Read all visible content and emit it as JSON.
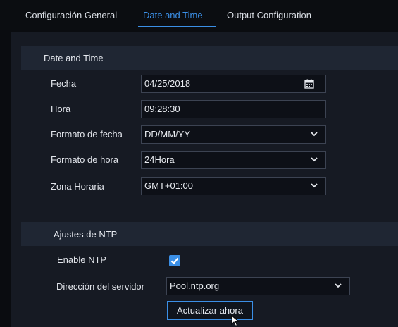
{
  "tabs": [
    {
      "label": "Configuración General",
      "active": false
    },
    {
      "label": "Date and Time",
      "active": true
    },
    {
      "label": "Output Configuration",
      "active": false
    }
  ],
  "date_time": {
    "section_title": "Date and Time",
    "fecha": {
      "label": "Fecha",
      "value": "04/25/2018",
      "icon": "calendar-icon"
    },
    "hora": {
      "label": "Hora",
      "value": "09:28:30"
    },
    "formato_fecha": {
      "label": "Formato de fecha",
      "value": "DD/MM/YY"
    },
    "formato_hora": {
      "label": "Formato de hora",
      "value": "24Hora"
    },
    "zona_horaria": {
      "label": "Zona Horaria",
      "value": "GMT+01:00"
    }
  },
  "ntp": {
    "section_title": "Ajustes de NTP",
    "enable_label": "Enable NTP",
    "enabled": true,
    "server_label": "Dirección del servidor",
    "server_value": "Pool.ntp.org",
    "update_button": "Actualizar ahora"
  },
  "colors": {
    "accent": "#3b8fe6",
    "panel": "#161a23",
    "header": "#1f2633",
    "field_bg": "#0d1017"
  }
}
